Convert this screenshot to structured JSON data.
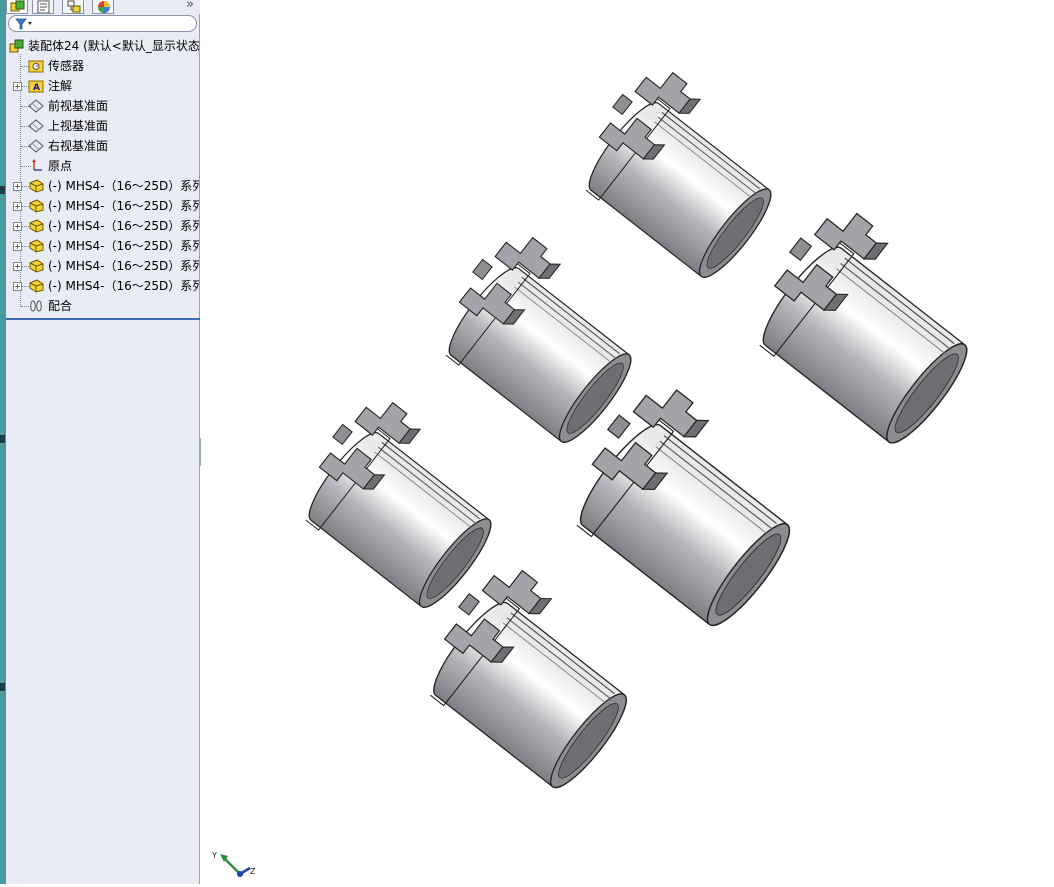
{
  "tabs": [
    {
      "name": "featuremanager-tab",
      "icon": "assembly-tree-icon",
      "active": true
    },
    {
      "name": "propertymanager-tab",
      "icon": "property-sheet-icon",
      "active": false
    },
    {
      "name": "configurationmanager-tab",
      "icon": "configuration-icon",
      "active": false
    },
    {
      "name": "displaymanager-tab",
      "icon": "color-wheel-icon",
      "active": false
    }
  ],
  "tabbar": {
    "overflow_label": "»"
  },
  "tree": {
    "root": "装配体24  (默认<默认_显示状态",
    "items": [
      {
        "label": "传感器",
        "icon": "sensor-folder-icon",
        "expandable": false
      },
      {
        "label": "注解",
        "icon": "annotation-folder-icon",
        "expandable": true
      },
      {
        "label": "前视基准面",
        "icon": "plane-icon",
        "expandable": false
      },
      {
        "label": "上视基准面",
        "icon": "plane-icon",
        "expandable": false
      },
      {
        "label": "右视基准面",
        "icon": "plane-icon",
        "expandable": false
      },
      {
        "label": "原点",
        "icon": "origin-icon",
        "expandable": false
      },
      {
        "label": "(-) MHS4-（16～25D）系列",
        "icon": "component-icon",
        "expandable": true
      },
      {
        "label": "(-) MHS4-（16～25D）系列",
        "icon": "component-icon",
        "expandable": true
      },
      {
        "label": "(-) MHS4-（16～25D）系列",
        "icon": "component-icon",
        "expandable": true
      },
      {
        "label": "(-) MHS4-（16～25D）系列",
        "icon": "component-icon",
        "expandable": true
      },
      {
        "label": "(-) MHS4-（16～25D）系列",
        "icon": "component-icon",
        "expandable": true
      },
      {
        "label": "(-) MHS4-（16～25D）系列",
        "icon": "component-icon",
        "expandable": true
      },
      {
        "label": "配合",
        "icon": "mates-icon",
        "expandable": false
      }
    ]
  },
  "triad": {
    "y_label": "Y",
    "z_label": "Z"
  },
  "colors": {
    "panel": "#e9ecf4",
    "strip": "#4a9aa2",
    "part_body": "#b9b9be",
    "part_dark": "#7e7e84",
    "accent_rule": "#3f6fb0"
  }
}
